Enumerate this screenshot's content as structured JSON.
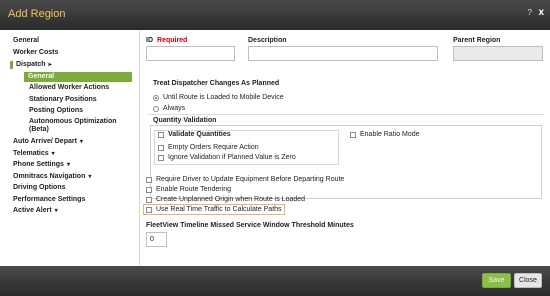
{
  "window": {
    "title": "Add Region",
    "help": "?",
    "close": "x"
  },
  "sidebar": {
    "general": "General",
    "worker_costs": "Worker Costs",
    "dispatch": "Dispatch",
    "dispatch_sub": {
      "general": "General",
      "allowed_worker_actions": "Allowed Worker Actions",
      "stationary_positions": "Stationary Positions",
      "posting_options": "Posting Options",
      "autonomous_opt_line1": "Autonomous Optimization",
      "autonomous_opt_line2": "(Beta)"
    },
    "auto_arrive": "Auto Arrive/ Depart",
    "telematics": "Telematics",
    "phone_settings": "Phone Settings",
    "omnitracs_navigation": "Omnitracs Navigation",
    "driving_options": "Driving Options",
    "performance_settings": "Performance Settings",
    "active_alert": "Active Alert"
  },
  "form": {
    "id_label": "ID",
    "required": "Required",
    "description_label": "Description",
    "parent_region_label": "Parent Region",
    "treat_dispatcher_title": "Treat Dispatcher Changes As Planned",
    "radio_until_route": "Until Route is Loaded to Mobile Device",
    "radio_always": "Always",
    "quantity_validation_title": "Quantity Validation",
    "validate_quantities": "Validate Quantities",
    "empty_orders": "Empty Orders Require Action",
    "ignore_validation": "Ignore Validation if Planned Value is Zero",
    "enable_ratio_mode": "Enable Ratio Mode",
    "require_driver_update": "Require Driver to Update Equipment Before Departing Route",
    "enable_route_tendering": "Enable Route Tendering",
    "create_unplanned_origin": "Create Unplanned Origin when Route is Loaded",
    "use_real_time_traffic": "Use Real Time Traffic to Calculate Paths",
    "fleetview_label": "FleetView Timeline Missed Service Window Threshold Minutes",
    "fleetview_value": "0"
  },
  "footer": {
    "save": "Save",
    "close": "Close"
  },
  "colors": {
    "accent_green": "#7aab3b",
    "title_text": "#f0c85a",
    "required_red": "#cc0000"
  }
}
